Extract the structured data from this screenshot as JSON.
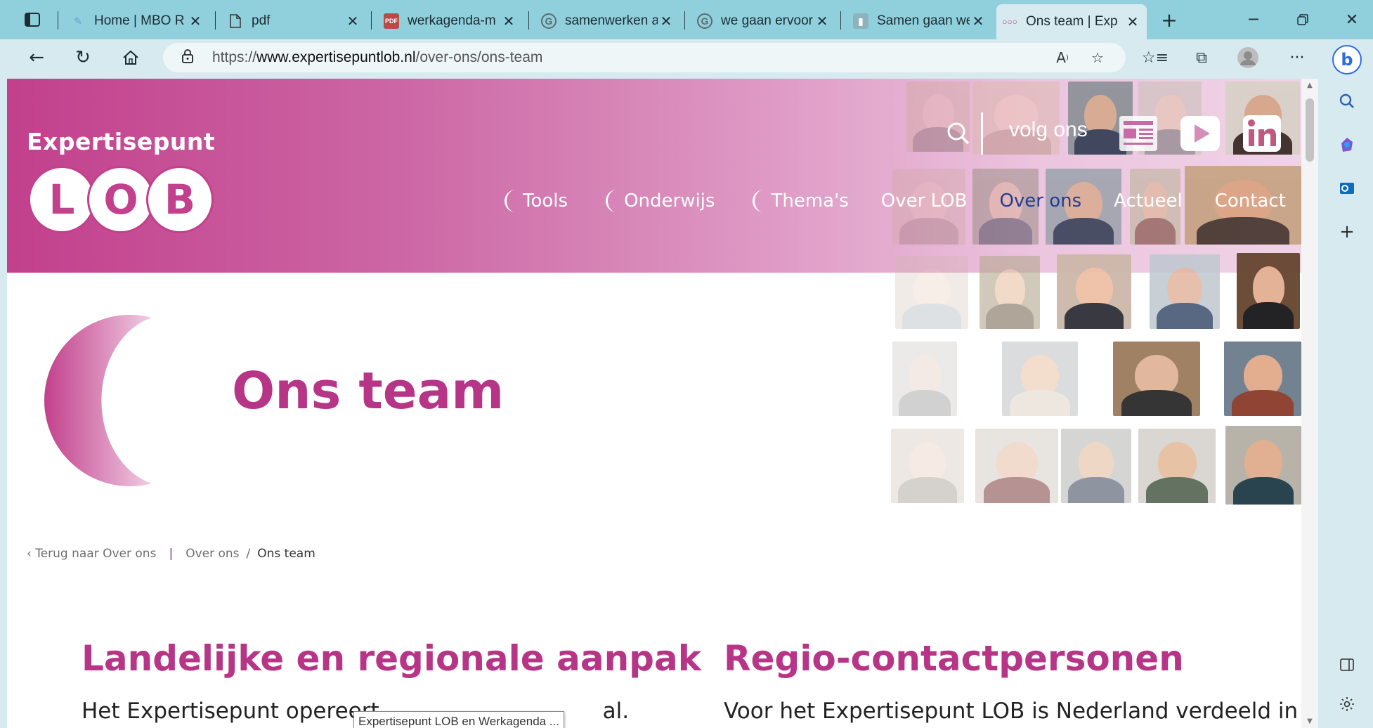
{
  "browser": {
    "tabs": [
      {
        "title": "Home | MBO R",
        "icon": "mbo-logo-icon"
      },
      {
        "title": "pdf",
        "icon": "document-icon"
      },
      {
        "title": "werkagenda-m",
        "icon": "pdf-icon"
      },
      {
        "title": "samenwerken a",
        "icon": "google-icon"
      },
      {
        "title": "we gaan ervoor",
        "icon": "google-icon"
      },
      {
        "title": "Samen gaan we",
        "icon": "site-icon"
      },
      {
        "title": "Ons team | Exp",
        "icon": "lob-icon",
        "active": true
      }
    ],
    "address": {
      "prefix": "https://",
      "host": "www.expertisepuntlob.nl",
      "path": "/over-ons/ons-team"
    },
    "accent": "#8fd0dc"
  },
  "site": {
    "logo_word": "Expertisepunt",
    "logo_letters": [
      "L",
      "O",
      "B"
    ],
    "follow_label": "volg ons",
    "nav": [
      {
        "label": "Tools",
        "moon": true
      },
      {
        "label": "Onderwijs",
        "moon": true
      },
      {
        "label": "Thema's",
        "moon": true
      },
      {
        "label": "Over LOB",
        "moon": false
      },
      {
        "label": "Over ons",
        "moon": false,
        "current": true
      },
      {
        "label": "Actueel",
        "moon": false
      },
      {
        "label": "Contact",
        "moon": false
      }
    ],
    "brand_color": "#c2408c",
    "current_nav_color": "#253e8c"
  },
  "page": {
    "title": "Ons team",
    "breadcrumb": {
      "back": "‹ Terug naar Over ons",
      "parent": "Over ons",
      "current": "Ons team"
    },
    "sections": [
      {
        "heading": "Landelijke en regionale aanpak",
        "text": "Het Expertisepunt opereert",
        "text_after_tooltip": "al."
      },
      {
        "heading": "Regio-contactpersonen",
        "text": "Voor het Expertisepunt LOB is Nederland verdeeld in"
      }
    ],
    "tooltip": "Expertisepunt LOB en Werkagenda ..."
  }
}
